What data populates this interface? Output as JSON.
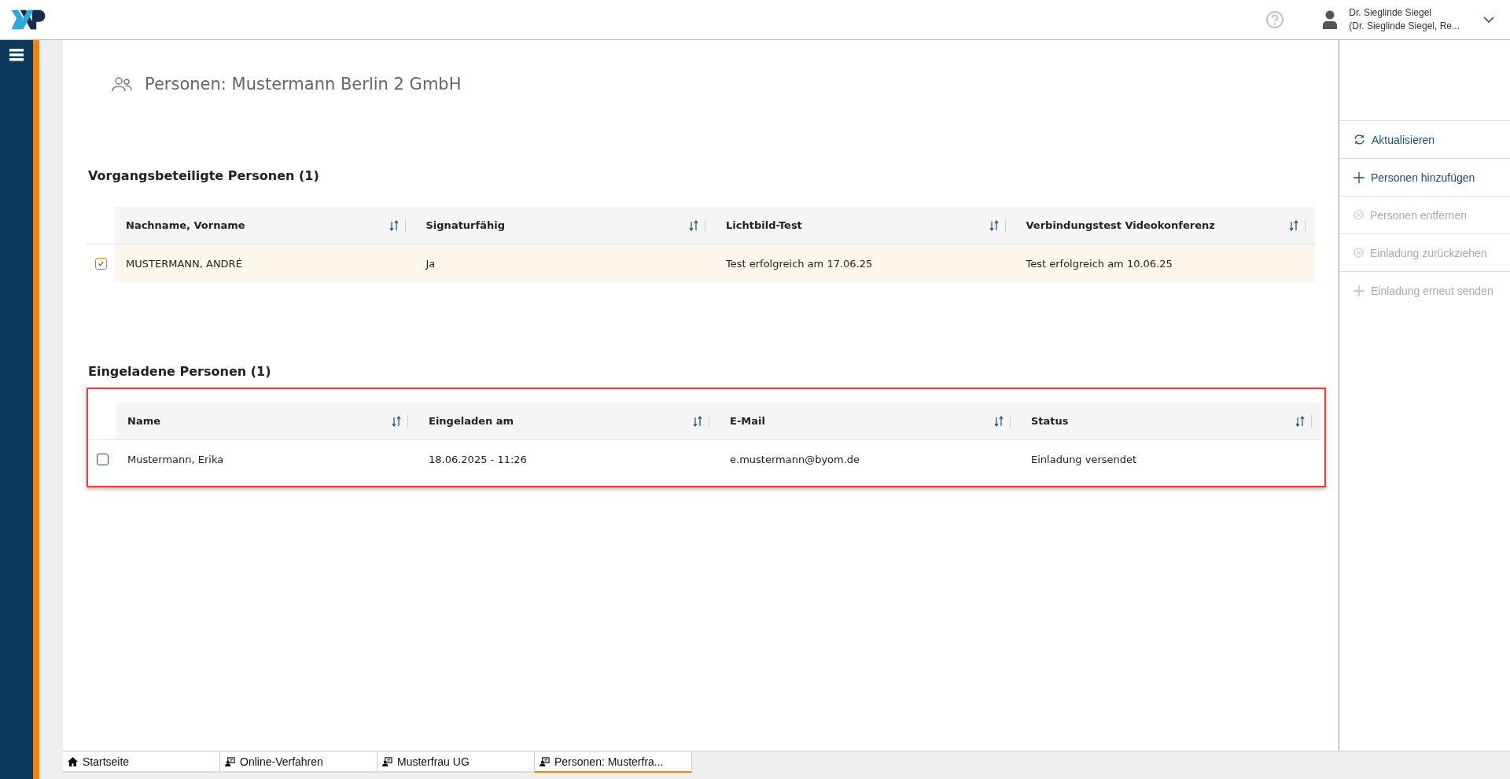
{
  "header": {
    "user_name": "Dr. Sieglinde Siegel",
    "user_role": "(Dr. Sieglinde Siegel, Re..."
  },
  "page_title": "Personen: Mustermann Berlin 2 GmbH",
  "sections": [
    {
      "heading": "Vorgangsbeteiligte Personen (1)",
      "highlighted": false,
      "columns": [
        "Nachname, Vorname",
        "Signaturfähig",
        "Lichtbild-Test",
        "Verbindungstest Videokonferenz"
      ],
      "rows": [
        {
          "checked": true,
          "cells": [
            "MUSTERMANN, ANDRÉ",
            "Ja",
            "Test erfolgreich am 17.06.25",
            "Test erfolgreich am 10.06.25"
          ]
        }
      ]
    },
    {
      "heading": "Eingeladene Personen (1)",
      "highlighted": true,
      "columns": [
        "Name",
        "Eingeladen am",
        "E-Mail",
        "Status"
      ],
      "rows": [
        {
          "checked": false,
          "cells": [
            "Mustermann, Erika",
            "18.06.2025 - 11:26",
            "e.mustermann@byom.de",
            "Einladung versendet"
          ]
        }
      ]
    }
  ],
  "actions": [
    {
      "label": "Aktualisieren",
      "kind": "refresh",
      "disabled": false
    },
    {
      "label": "Personen hinzufügen",
      "kind": "add",
      "disabled": false
    },
    {
      "label": "Personen entfernen",
      "kind": "remove",
      "disabled": true
    },
    {
      "label": "Einladung zurückziehen",
      "kind": "remove",
      "disabled": true
    },
    {
      "label": "Einladung erneut senden",
      "kind": "add",
      "disabled": true
    }
  ],
  "tabs": [
    {
      "label": "Startseite",
      "kind": "home",
      "selected": false
    },
    {
      "label": "Online-Verfahren",
      "kind": "case",
      "selected": false
    },
    {
      "label": "Musterfrau UG",
      "kind": "case",
      "selected": false
    },
    {
      "label": "Personen: Musterfra...",
      "kind": "case",
      "selected": true
    }
  ]
}
